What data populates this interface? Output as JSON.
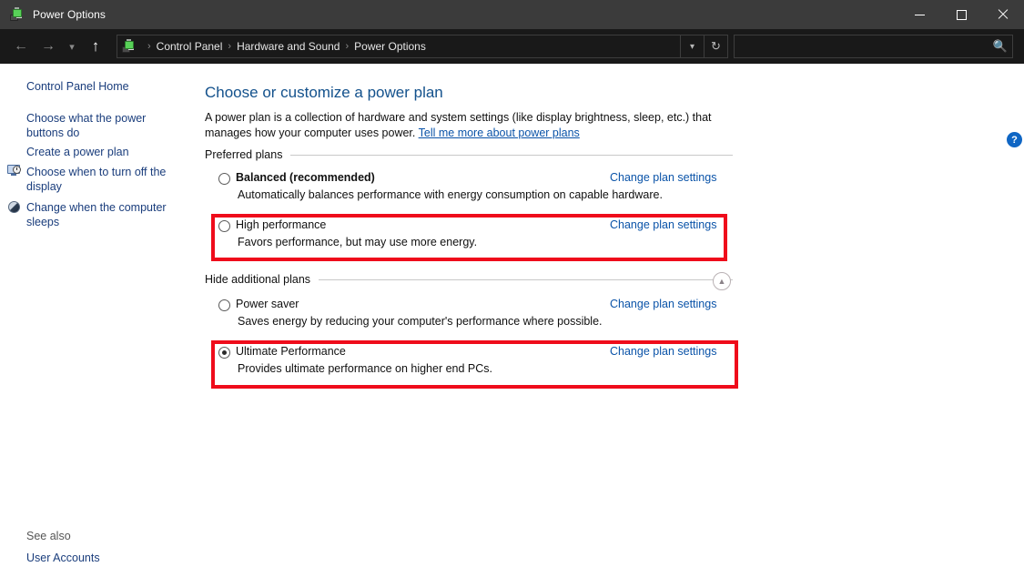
{
  "window": {
    "title": "Power Options",
    "icon": "power-plug-battery-icon",
    "minimize_label": "Minimize",
    "maximize_label": "Maximize",
    "close_label": "Close"
  },
  "navbar": {
    "back_label": "Back",
    "forward_label": "Forward",
    "recent_label": "Recent locations",
    "up_label": "Up one level",
    "breadcrumb": [
      "Control Panel",
      "Hardware and Sound",
      "Power Options"
    ],
    "separator": "›",
    "caret_label": "Previous locations",
    "refresh_label": "Refresh"
  },
  "search": {
    "value": "",
    "placeholder": "",
    "icon": "search-icon"
  },
  "sidebar": {
    "items": [
      {
        "label": "Control Panel Home",
        "icon": null
      },
      {
        "label": "Choose what the power buttons do",
        "icon": null
      },
      {
        "label": "Create a power plan",
        "icon": null
      },
      {
        "label": "Choose when to turn off the display",
        "icon": "display-clock-icon"
      },
      {
        "label": "Change when the computer sleeps",
        "icon": "moon-sleep-icon"
      }
    ],
    "see_also_label": "See also",
    "see_also_items": [
      {
        "label": "User Accounts"
      }
    ]
  },
  "main": {
    "title": "Choose or customize a power plan",
    "description_part1": "A power plan is a collection of hardware and system settings (like display brightness, sleep, etc.) that manages how your computer uses power. ",
    "description_link": "Tell me more about power plans",
    "preferred_group_label": "Preferred plans",
    "additional_group_label": "Hide additional plans",
    "collapse_icon": "chevron-up-icon",
    "change_plan_label": "Change plan settings",
    "preferred_plans": [
      {
        "name": "Balanced (recommended)",
        "description": "Automatically balances performance with energy consumption on capable hardware.",
        "selected": false,
        "bold": true,
        "highlighted": false
      },
      {
        "name": "High performance",
        "description": "Favors performance, but may use more energy.",
        "selected": false,
        "bold": false,
        "highlighted": true
      }
    ],
    "additional_plans": [
      {
        "name": "Power saver",
        "description": "Saves energy by reducing your computer's performance where possible.",
        "selected": false,
        "bold": false,
        "highlighted": false
      },
      {
        "name": "Ultimate Performance",
        "description": "Provides ultimate performance on higher end PCs.",
        "selected": true,
        "bold": false,
        "highlighted": true
      }
    ]
  },
  "help": {
    "label": "?",
    "icon": "help-circle-icon"
  },
  "colors": {
    "titlebar_bg": "#3b3b3b",
    "navbar_bg": "#191919",
    "link": "#0a53a8",
    "heading": "#13518c",
    "annotation_red": "#ef0c1b",
    "help_blue": "#0f66c4"
  }
}
